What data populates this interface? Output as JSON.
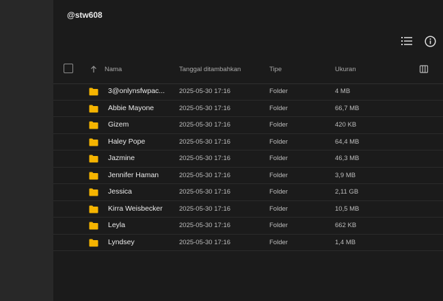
{
  "header": {
    "title": "@stw608"
  },
  "columns": {
    "name": "Nama",
    "date_added": "Tanggal ditambahkan",
    "type": "Tipe",
    "size": "Ukuran"
  },
  "icons": {
    "list_view": "list-view-icon",
    "info": "info-icon",
    "sort": "arrow-up-icon",
    "columns": "columns-icon",
    "folder": "folder-icon"
  },
  "colors": {
    "folder": "#f5b400",
    "sidebar": "#282828",
    "background": "#1b1b1b"
  },
  "rows": [
    {
      "name": "3@onlynsfwpac...",
      "date": "2025-05-30 17:16",
      "type": "Folder",
      "size": "4 MB"
    },
    {
      "name": "Abbie Mayone",
      "date": "2025-05-30 17:16",
      "type": "Folder",
      "size": "66,7 MB"
    },
    {
      "name": "Gizem",
      "date": "2025-05-30 17:16",
      "type": "Folder",
      "size": "420 KB"
    },
    {
      "name": "Haley Pope",
      "date": "2025-05-30 17:16",
      "type": "Folder",
      "size": "64,4 MB"
    },
    {
      "name": "Jazmine",
      "date": "2025-05-30 17:16",
      "type": "Folder",
      "size": "46,3 MB"
    },
    {
      "name": "Jennifer Haman",
      "date": "2025-05-30 17:16",
      "type": "Folder",
      "size": "3,9 MB"
    },
    {
      "name": "Jessica",
      "date": "2025-05-30 17:16",
      "type": "Folder",
      "size": "2,11 GB"
    },
    {
      "name": "Kirra Weisbecker",
      "date": "2025-05-30 17:16",
      "type": "Folder",
      "size": "10,5 MB"
    },
    {
      "name": "Leyla",
      "date": "2025-05-30 17:16",
      "type": "Folder",
      "size": "662 KB"
    },
    {
      "name": "Lyndsey",
      "date": "2025-05-30 17:16",
      "type": "Folder",
      "size": "1,4 MB"
    }
  ]
}
